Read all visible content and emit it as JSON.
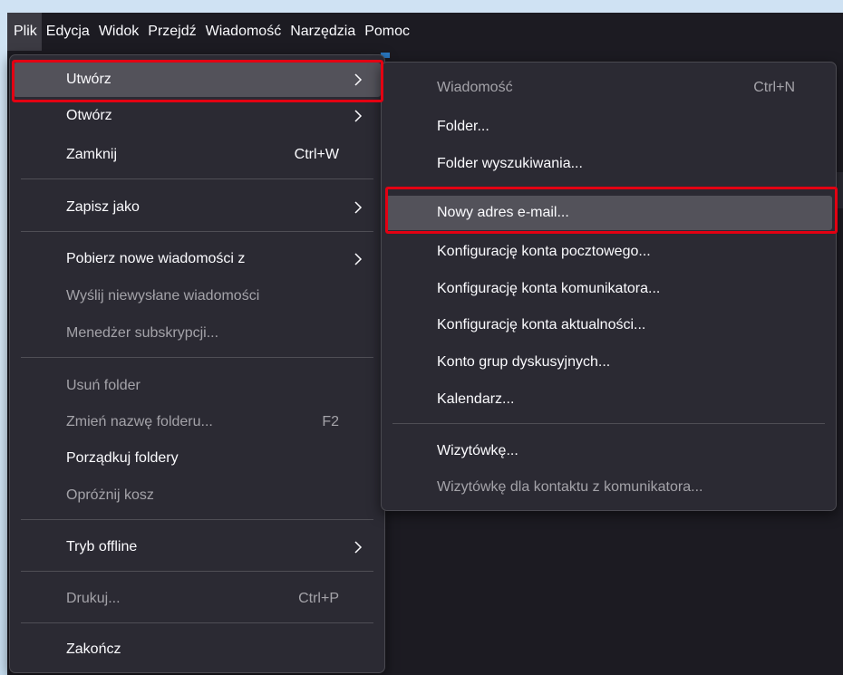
{
  "menubar": {
    "items": [
      "Plik",
      "Edycja",
      "Widok",
      "Przejdź",
      "Wiadomość",
      "Narzędzia",
      "Pomoc"
    ]
  },
  "file_menu": {
    "new": "Utwórz",
    "open": "Otwórz",
    "close": "Zamknij",
    "close_shortcut": "Ctrl+W",
    "save_as": "Zapisz jako",
    "get_new_messages": "Pobierz nowe wiadomości z",
    "send_unsent": "Wyślij niewysłane wiadomości",
    "subscriptions": "Menedżer subskrypcji...",
    "delete_folder": "Usuń folder",
    "rename_folder": "Zmień nazwę folderu...",
    "rename_shortcut": "F2",
    "compact_folders": "Porządkuj foldery",
    "empty_trash": "Opróżnij kosz",
    "offline": "Tryb offline",
    "print": "Drukuj...",
    "print_shortcut": "Ctrl+P",
    "quit": "Zakończ"
  },
  "new_submenu": {
    "message": "Wiadomość",
    "message_shortcut": "Ctrl+N",
    "folder": "Folder...",
    "search_folder": "Folder wyszukiwania...",
    "new_email": "Nowy adres e-mail...",
    "mail_account": "Konfigurację konta pocztowego...",
    "chat_account": "Konfigurację konta komunikatora...",
    "feed_account": "Konfigurację konta aktualności...",
    "newsgroup_account": "Konto grup dyskusyjnych...",
    "calendar": "Kalendarz...",
    "contact": "Wizytówkę...",
    "chat_contact": "Wizytówkę dla kontaktu z komunikatora..."
  },
  "colors": {
    "highlight_border": "#e30012",
    "menu_bg": "#2b2a33",
    "hover_bg": "#53525a"
  }
}
